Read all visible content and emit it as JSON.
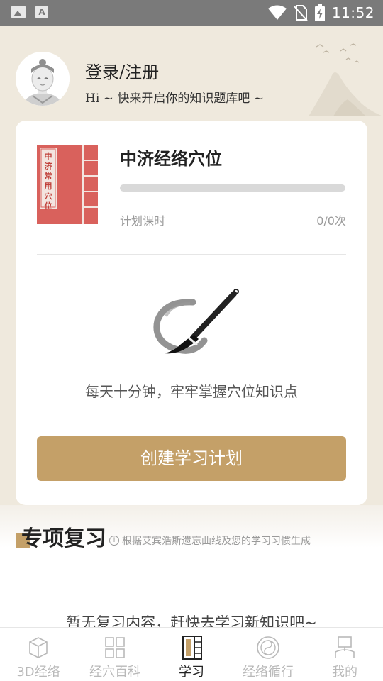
{
  "status_bar": {
    "time": "11:52",
    "icons": [
      "image-icon",
      "a-icon",
      "wifi-icon",
      "no-sim-icon",
      "battery-charging-icon"
    ],
    "a_icon_text": "A"
  },
  "header": {
    "login_title": "登录/注册",
    "login_subtitle": "Hi ~ 快来开启你的知识题库吧 ~"
  },
  "course": {
    "cover_text": "中济常用穴位",
    "title": "中济经络穴位",
    "progress_fraction": 0,
    "plan_label": "计划课时",
    "plan_count": "0/0次",
    "motto": "每天十分钟，牢牢掌握穴位知识点",
    "create_button": "创建学习计划"
  },
  "review": {
    "title": "专项复习",
    "info_text": "根据艾宾浩斯遗忘曲线及您的学习习惯生成",
    "empty_text": "暂无复习内容，赶快去学习新知识吧~"
  },
  "colors": {
    "accent": "#c4a068",
    "background": "#efe9dd",
    "book_red": "#d9615c"
  },
  "bottom_nav": {
    "items": [
      {
        "label": "3D经络",
        "icon": "cube-icon"
      },
      {
        "label": "经穴百科",
        "icon": "grid-icon"
      },
      {
        "label": "学习",
        "icon": "book-icon"
      },
      {
        "label": "经络循行",
        "icon": "yinyang-icon"
      },
      {
        "label": "我的",
        "icon": "person-icon"
      }
    ],
    "active_index": 2
  }
}
